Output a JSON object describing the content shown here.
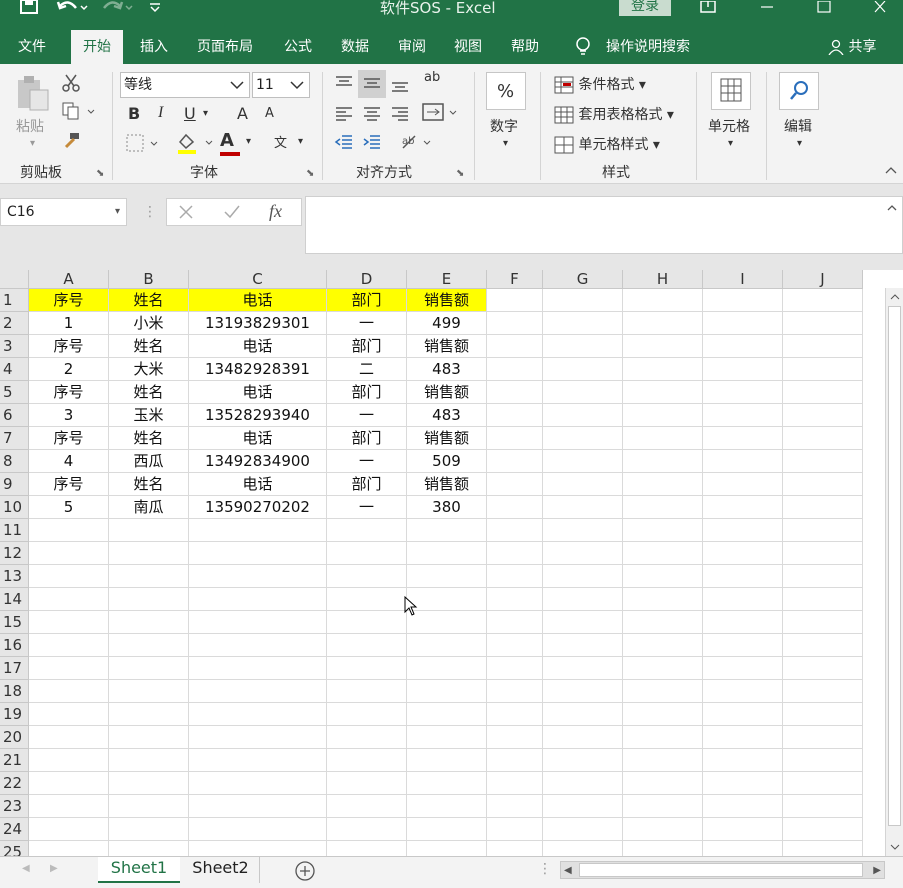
{
  "window": {
    "title": "软件SOS  -  Excel",
    "login_label": "登录",
    "quick_access": {
      "save_icon": "save-icon",
      "undo_icon": "undo-icon",
      "redo_icon": "redo-icon",
      "customize_icon": "chevron-down-icon"
    }
  },
  "tabs": [
    {
      "label": "文件"
    },
    {
      "label": "开始"
    },
    {
      "label": "插入"
    },
    {
      "label": "页面布局"
    },
    {
      "label": "公式"
    },
    {
      "label": "数据"
    },
    {
      "label": "审阅"
    },
    {
      "label": "视图"
    },
    {
      "label": "帮助"
    },
    {
      "label": "操作说明搜索"
    },
    {
      "label": "共享"
    }
  ],
  "ribbon": {
    "clipboard": {
      "paste_label": "粘贴",
      "group_label": "剪贴板"
    },
    "font": {
      "font_name": "等线",
      "font_size": "11",
      "group_label": "字体",
      "bold": "B",
      "italic": "I",
      "underline": "U",
      "font_color_glyph": "A",
      "increase_glyph": "A",
      "decrease_glyph": "A",
      "phonetic_glyph": "文"
    },
    "alignment": {
      "group_label": "对齐方式",
      "wrap_glyph": "ab"
    },
    "number": {
      "label": "数字",
      "percent_glyph": "%"
    },
    "styles": {
      "conditional": "条件格式",
      "table": "套用表格格式",
      "cell_styles": "单元格样式",
      "group_label": "样式"
    },
    "cells": {
      "label": "单元格"
    },
    "editing": {
      "label": "编辑"
    }
  },
  "formula_bar": {
    "name_box": "C16",
    "fx_label": "fx",
    "formula": ""
  },
  "grid": {
    "columns": [
      "A",
      "B",
      "C",
      "D",
      "E",
      "F",
      "G",
      "H",
      "I",
      "J"
    ],
    "rows": [
      [
        "序号",
        "姓名",
        "电话",
        "部门",
        "销售额"
      ],
      [
        "1",
        "小米",
        "13193829301",
        "一",
        "499"
      ],
      [
        "序号",
        "姓名",
        "电话",
        "部门",
        "销售额"
      ],
      [
        "2",
        "大米",
        "13482928391",
        "二",
        "483"
      ],
      [
        "序号",
        "姓名",
        "电话",
        "部门",
        "销售额"
      ],
      [
        "3",
        "玉米",
        "13528293940",
        "一",
        "483"
      ],
      [
        "序号",
        "姓名",
        "电话",
        "部门",
        "销售额"
      ],
      [
        "4",
        "西瓜",
        "13492834900",
        "一",
        "509"
      ],
      [
        "序号",
        "姓名",
        "电话",
        "部门",
        "销售额"
      ],
      [
        "5",
        "南瓜",
        "13590270202",
        "一",
        "380"
      ]
    ],
    "row_numbers": [
      "1",
      "2",
      "3",
      "4",
      "5",
      "6",
      "7",
      "8",
      "9",
      "10",
      "11",
      "12",
      "13",
      "14",
      "15",
      "16",
      "17",
      "18",
      "19",
      "20",
      "21",
      "22",
      "23",
      "24",
      "25"
    ],
    "highlight_color": "#ffff00"
  },
  "sheets": [
    {
      "label": "Sheet1"
    },
    {
      "label": "Sheet2"
    }
  ],
  "colors": {
    "accent": "#217346"
  }
}
